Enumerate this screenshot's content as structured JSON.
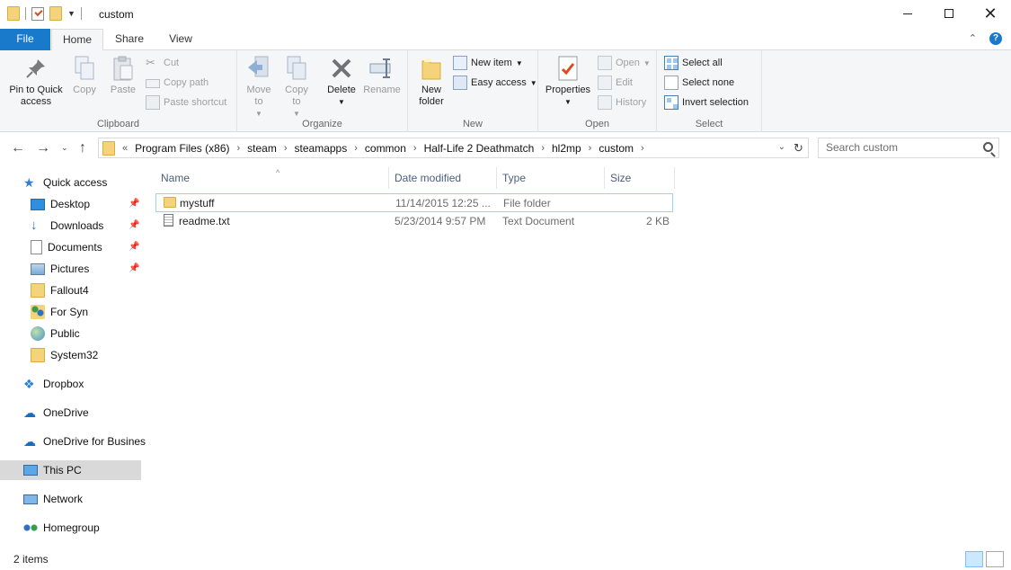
{
  "window": {
    "title": "custom"
  },
  "ribbon_tabs": {
    "file": "File",
    "home": "Home",
    "share": "Share",
    "view": "View"
  },
  "clipboard": {
    "label": "Clipboard",
    "pin": "Pin to Quick access",
    "copy": "Copy",
    "paste": "Paste",
    "cut": "Cut",
    "copy_path": "Copy path",
    "paste_shortcut": "Paste shortcut"
  },
  "organize": {
    "label": "Organize",
    "move_to": "Move to",
    "copy_to": "Copy to",
    "delete": "Delete",
    "rename": "Rename"
  },
  "new_group": {
    "label": "New",
    "new_folder": "New folder",
    "new_item": "New item",
    "easy_access": "Easy access"
  },
  "open_group": {
    "label": "Open",
    "properties": "Properties",
    "open": "Open",
    "edit": "Edit",
    "history": "History"
  },
  "select_group": {
    "label": "Select",
    "select_all": "Select all",
    "select_none": "Select none",
    "invert": "Invert selection"
  },
  "address": {
    "overflow": "«",
    "crumbs": [
      "Program Files (x86)",
      "steam",
      "steamapps",
      "common",
      "Half-Life 2 Deathmatch",
      "hl2mp",
      "custom"
    ]
  },
  "search": {
    "placeholder": "Search custom"
  },
  "nav": {
    "quick_access": "Quick access",
    "desktop": "Desktop",
    "downloads": "Downloads",
    "documents": "Documents",
    "pictures": "Pictures",
    "fallout4": "Fallout4",
    "for_syn": "For Syn",
    "public": "Public",
    "system32": "System32",
    "dropbox": "Dropbox",
    "onedrive": "OneDrive",
    "onedrive_business": "OneDrive for Busines",
    "this_pc": "This PC",
    "network": "Network",
    "homegroup": "Homegroup"
  },
  "columns": {
    "name": "Name",
    "date": "Date modified",
    "type": "Type",
    "size": "Size"
  },
  "files": [
    {
      "name": "mystuff",
      "date": "11/14/2015 12:25 ...",
      "type": "File folder",
      "size": ""
    },
    {
      "name": "readme.txt",
      "date": "5/23/2014 9:57 PM",
      "type": "Text Document",
      "size": "2 KB"
    }
  ],
  "status": {
    "items": "2 items"
  },
  "colors": {
    "accent": "#1979ca",
    "folder": "#f4d37b",
    "selection_border": "#99d1ff"
  }
}
